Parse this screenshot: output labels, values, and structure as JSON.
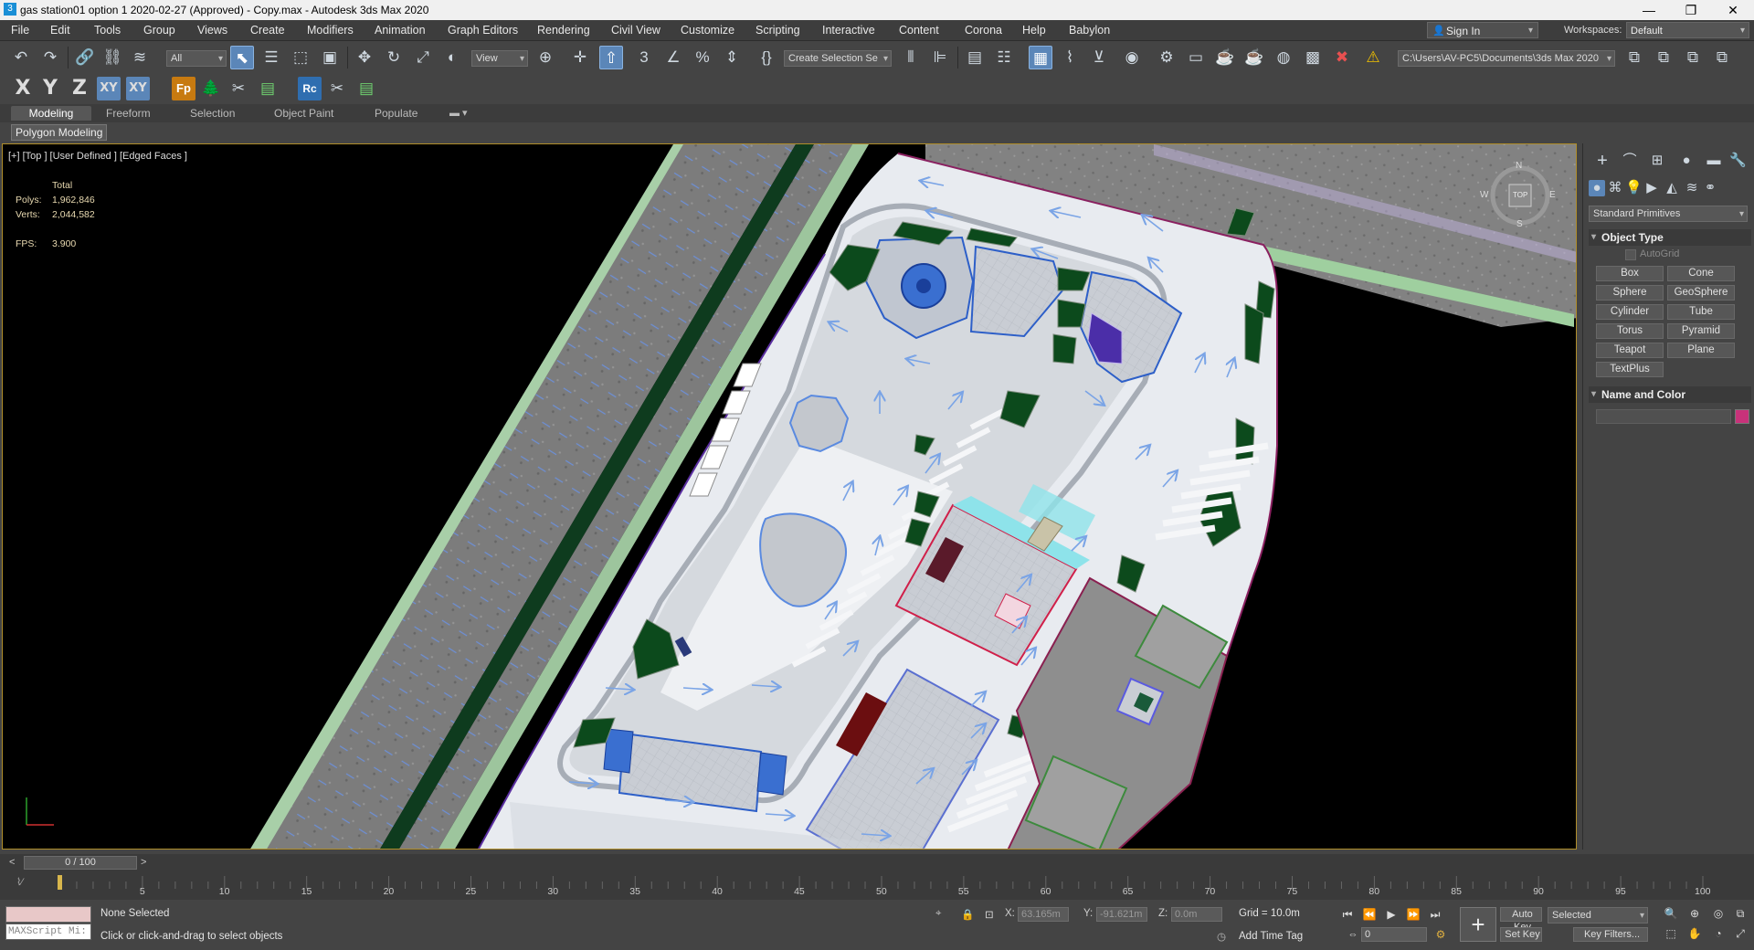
{
  "window": {
    "title": "gas station01 option 1 2020-02-27 (Approved) - Copy.max - Autodesk 3ds Max 2020",
    "min_glyph": "—",
    "max_glyph": "❐",
    "close_glyph": "✕"
  },
  "menu": [
    "File",
    "Edit",
    "Tools",
    "Group",
    "Views",
    "Create",
    "Modifiers",
    "Animation",
    "Graph Editors",
    "Rendering",
    "Civil View",
    "Customize",
    "Scripting",
    "Interactive",
    "Content",
    "Corona",
    "Help",
    "Babylon"
  ],
  "account": {
    "sign_in": "Sign In",
    "workspaces_label": "Workspaces:",
    "workspace": "Default"
  },
  "toolbar": {
    "selection_filter": "All",
    "ref_coord": "View",
    "selection_set": "Create Selection Se",
    "project_path": "C:\\Users\\AV-PC5\\Documents\\3ds Max 2020"
  },
  "axis_toolbar": [
    "X",
    "Y",
    "Z",
    "XY",
    "XY"
  ],
  "ribbon": {
    "tabs": [
      "Modeling",
      "Freeform",
      "Selection",
      "Object Paint",
      "Populate"
    ],
    "active_tab": "Modeling",
    "panel_label": "Polygon Modeling"
  },
  "viewport": {
    "label": "[+] [Top ] [User Defined ] [Edged Faces ]",
    "stats": {
      "total_label": "Total",
      "polys_label": "Polys:",
      "polys": "1,962,846",
      "verts_label": "Verts:",
      "verts": "2,044,582",
      "fps_label": "FPS:",
      "fps": "3.900"
    },
    "compass": {
      "n": "N",
      "s": "S",
      "e": "E",
      "w": "W",
      "cube": "TOP"
    }
  },
  "command_panel": {
    "category": "Standard Primitives",
    "object_type_title": "Object Type",
    "autogrid": "AutoGrid",
    "primitives": [
      "Box",
      "Cone",
      "Sphere",
      "GeoSphere",
      "Cylinder",
      "Tube",
      "Torus",
      "Pyramid",
      "Teapot",
      "Plane",
      "TextPlus"
    ],
    "name_color_title": "Name and Color",
    "object_color": "#c8327a"
  },
  "timeline": {
    "frame_counter": "0 / 100",
    "ticks": [
      "5",
      "10",
      "15",
      "20",
      "25",
      "30",
      "35",
      "40",
      "45",
      "50",
      "55",
      "60",
      "65",
      "70",
      "75",
      "80",
      "85",
      "90",
      "95",
      "100"
    ]
  },
  "status": {
    "maxscript": "MAXScript Mi:",
    "selection": "None Selected",
    "prompt": "Click or click-and-drag to select objects",
    "x_label": "X:",
    "x": "63.165m",
    "y_label": "Y:",
    "y": "-91.621m",
    "z_label": "Z:",
    "z": "0.0m",
    "grid": "Grid = 10.0m",
    "add_time_tag": "Add Time Tag",
    "auto_key": "Auto Key",
    "key_mode": "Selected",
    "set_key": "Set Key",
    "key_filters": "Key Filters...",
    "frame": "0"
  },
  "colors": {
    "ui_bg": "#444444",
    "viewport_bg": "#000000",
    "active_blue": "#5b86b8",
    "viewport_border": "#b08e2a",
    "road": "#8a8a8a",
    "pavement": "#e6e9ee",
    "planting": "#0c4a1c"
  }
}
